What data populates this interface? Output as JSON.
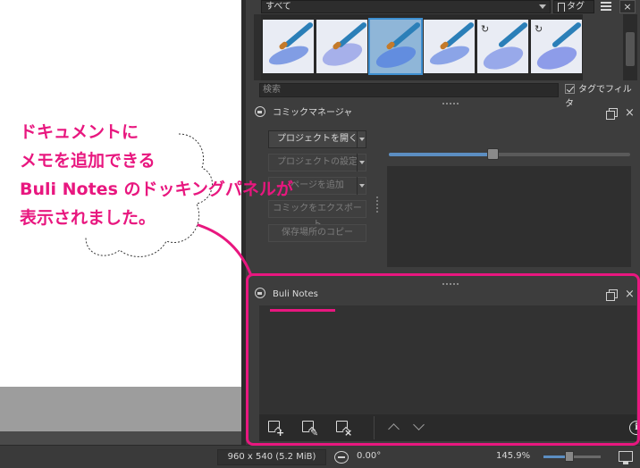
{
  "presets": {
    "tag_combo_value": "すべて",
    "tag_button_label": "タグ",
    "close_label": "×",
    "search_placeholder": "検索",
    "tag_filter_label": "タグでフィルタ",
    "brushes": [
      {
        "rotated": false,
        "selected": false
      },
      {
        "rotated": false,
        "selected": false
      },
      {
        "rotated": false,
        "selected": true
      },
      {
        "rotated": false,
        "selected": false
      },
      {
        "rotated": true,
        "selected": false
      },
      {
        "rotated": true,
        "selected": false
      }
    ]
  },
  "comic_manager": {
    "title": "コミックマネージャ",
    "buttons": {
      "open_project": "プロジェクトを開く",
      "project_settings": "プロジェクトの設定",
      "add_page": "ページを追加",
      "export": "コミックをエクスポート",
      "copy_location": "保存場所のコピー"
    },
    "zoom_slider_fraction": 0.43
  },
  "notes": {
    "title": "Buli Notes"
  },
  "statusbar": {
    "image_size": "960 x 540 (5.2 MiB)",
    "rotation": "0.00°",
    "zoom": "145.9%",
    "zoom_slider_fraction": 0.45
  },
  "annotation": {
    "text": "ドキュメントに\nメモを追加できる\nBuli Notes のドッキングパネルが\n表示されました。",
    "color": "#e8177f"
  },
  "colors": {
    "accent": "#e8177f",
    "selection": "#3e8fd0",
    "slider": "#5c8ec2"
  }
}
